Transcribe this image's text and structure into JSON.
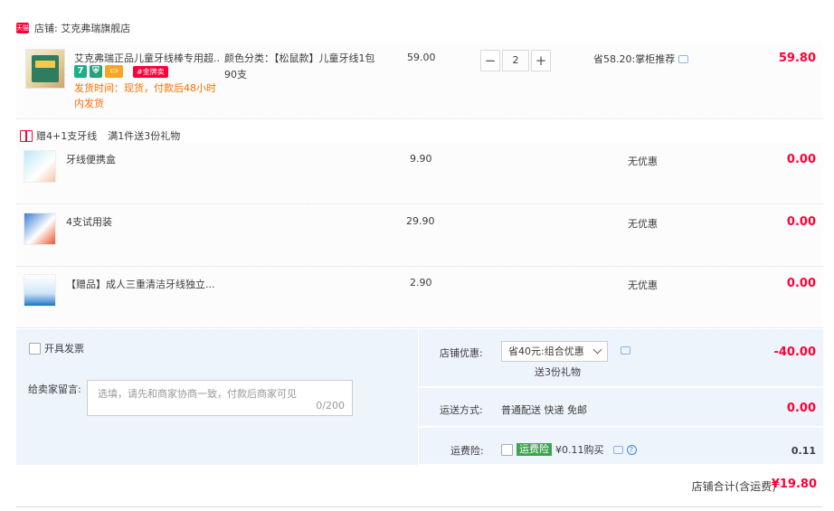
{
  "shop": {
    "badge": "天猫",
    "name": "店铺: 艾克弗瑞旗舰店"
  },
  "item": {
    "title": "艾克弗瑞正品儿童牙线棒专用超...",
    "icons": [
      "seven-day-return-icon",
      "shield-icon",
      "card-icon"
    ],
    "gold_tag": "#金牌卖",
    "ship_time": "发货时间：现货，付款后48小时内发货",
    "sku": "颜色分类：【松鼠款】儿童牙线1包90支",
    "price": "59.00",
    "quantity": "2",
    "minus": "−",
    "plus": "+",
    "saving": "省58.20:掌柜推荐",
    "subtotal": "59.80"
  },
  "gift_header": {
    "label": "赠4+1支牙线",
    "rule": "满1件送3份礼物"
  },
  "gifts": [
    {
      "name": "牙线便携盒",
      "price": "9.90",
      "discount": "无优惠",
      "subtotal": "0.00"
    },
    {
      "name": "4支试用装",
      "price": "29.90",
      "discount": "无优惠",
      "subtotal": "0.00"
    },
    {
      "name": "【赠品】成人三重清洁牙线独立...",
      "price": "2.90",
      "discount": "无优惠",
      "subtotal": "0.00"
    }
  ],
  "invoice": {
    "label": "开具发票"
  },
  "message": {
    "label": "给卖家留言:",
    "placeholder": "选填，请先和商家协商一致，付款后商家可见",
    "count": "0/200"
  },
  "shop_discount": {
    "label": "店铺优惠:",
    "selected": "省40元:组合优惠",
    "note": "送3份礼物",
    "amount": "-40.00"
  },
  "shipping": {
    "label": "运送方式:",
    "value": "普通配送 快递 免邮",
    "amount": "0.00"
  },
  "insurance": {
    "label": "运费险:",
    "tag": "运费险",
    "value": "¥0.11购买",
    "amount": "0.11"
  },
  "total": {
    "label": "店铺合计(含运费)",
    "value": "¥19.80"
  },
  "colors": {
    "accent": "#ff0036",
    "orange": "#ff6e00",
    "panel": "#eef4fc"
  }
}
